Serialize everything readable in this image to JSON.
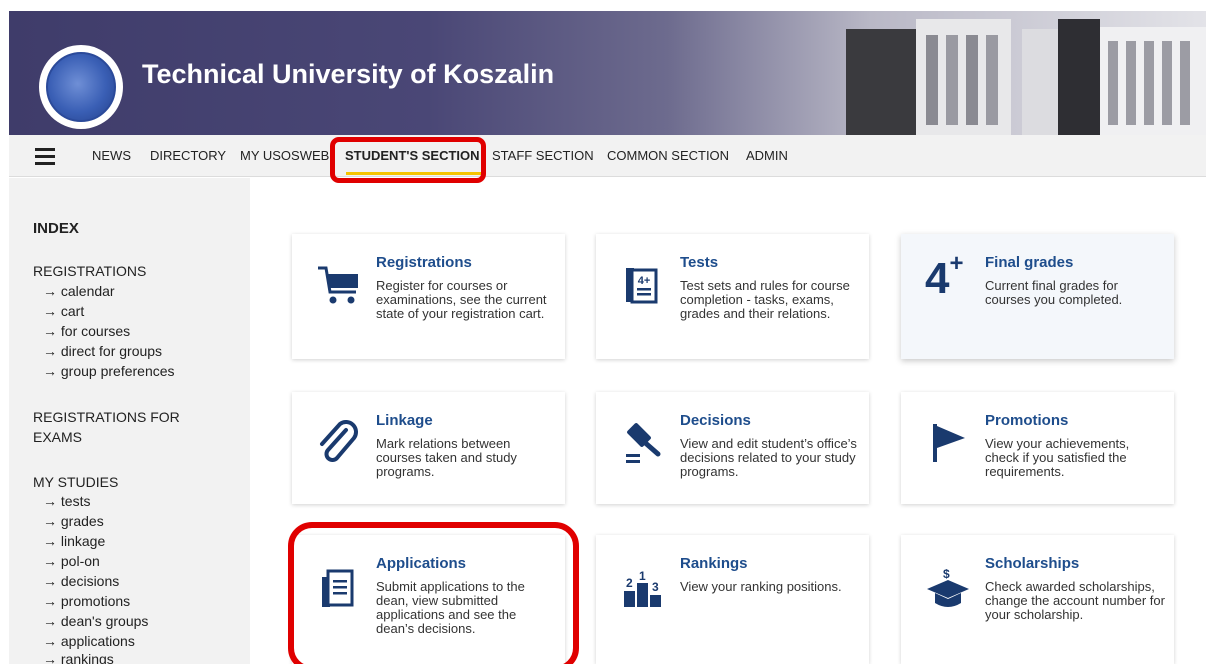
{
  "header": {
    "title": "Technical University of Koszalin"
  },
  "nav": {
    "items": [
      {
        "label": "NEWS"
      },
      {
        "label": "DIRECTORY"
      },
      {
        "label": "MY USOSWEB"
      },
      {
        "label": "STUDENT'S SECTION",
        "active": true
      },
      {
        "label": "STAFF SECTION"
      },
      {
        "label": "COMMON SECTION"
      },
      {
        "label": "ADMIN"
      }
    ]
  },
  "sidebar": {
    "index": "INDEX",
    "groups": [
      {
        "heading": "REGISTRATIONS",
        "items": [
          "calendar",
          "cart",
          "for courses",
          "direct for groups",
          "group preferences"
        ]
      },
      {
        "heading": "REGISTRATIONS FOR EXAMS",
        "items": []
      },
      {
        "heading": "MY STUDIES",
        "items": [
          "tests",
          "grades",
          "linkage",
          "pol-on",
          "decisions",
          "promotions",
          "dean's groups",
          "applications",
          "rankings"
        ]
      }
    ],
    "arrow": "→"
  },
  "cards": [
    {
      "title": "Registrations",
      "desc": "Register for courses or examinations, see the current state of your registration cart.",
      "icon": "cart-icon"
    },
    {
      "title": "Tests",
      "desc": "Test sets and rules for course completion - tasks, exams, grades and their relations.",
      "icon": "test-sheet-icon"
    },
    {
      "title": "Final grades",
      "desc": "Current final grades for courses you completed.",
      "icon": "grade-icon",
      "icon_text": "4",
      "icon_sup": "+"
    },
    {
      "title": "Linkage",
      "desc": "Mark relations between courses taken and study programs.",
      "icon": "paperclip-icon"
    },
    {
      "title": "Decisions",
      "desc": "View and edit student’s office’s decisions related to your study programs.",
      "icon": "gavel-icon"
    },
    {
      "title": "Promotions",
      "desc": "View your achievements, check if you satisfied the requirements.",
      "icon": "flag-icon"
    },
    {
      "title": "Applications",
      "desc": "Submit applications to the dean, view submitted applications and see the dean’s decisions.",
      "icon": "document-icon"
    },
    {
      "title": "Rankings",
      "desc": "View your ranking positions.",
      "icon": "podium-icon"
    },
    {
      "title": "Scholarships",
      "desc": "Check awarded scholarships, change the account number for your scholarship.",
      "icon": "graduation-cap-icon"
    }
  ],
  "colors": {
    "accent": "#1e4d8c",
    "highlight": "#e00000",
    "active_underline": "#f5c400"
  }
}
